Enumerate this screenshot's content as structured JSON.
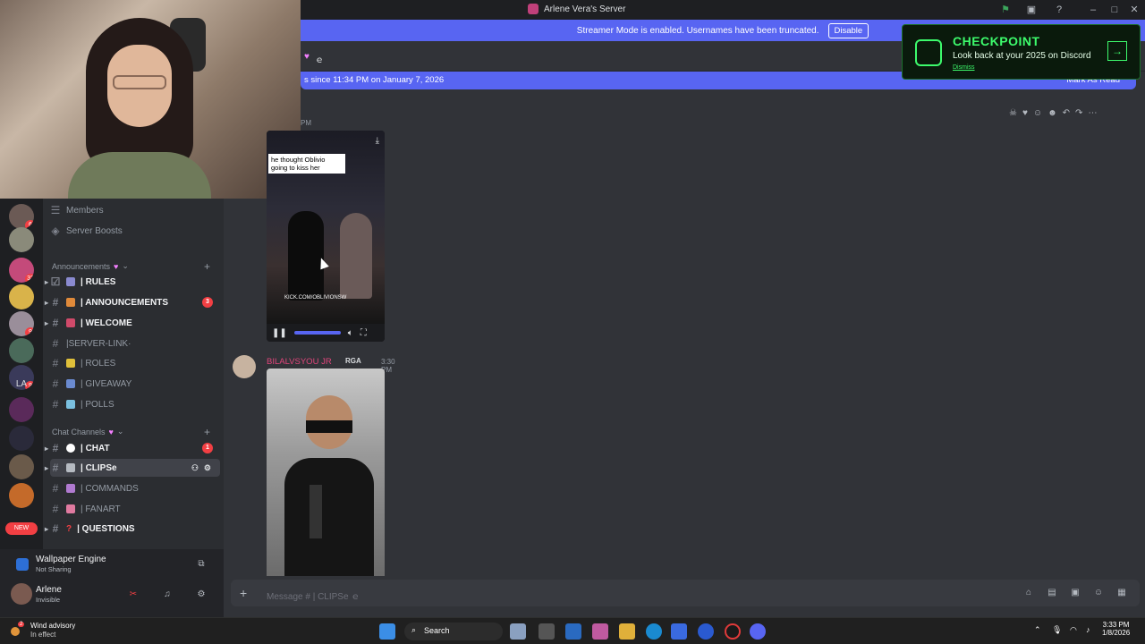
{
  "window": {
    "title": "Arlene Vera's Server"
  },
  "streamer_banner": {
    "text": "Streamer Mode is enabled. Usernames have been truncated.",
    "button": "Disable"
  },
  "channel_header": {
    "title": "ｅ"
  },
  "new_messages": {
    "text": "s since 11:34 PM on January 7, 2026",
    "action": "Mark As Read"
  },
  "checkpoint": {
    "title": "CHECKPOINT",
    "subtitle": "Look back at your 2025 on Discord",
    "dismiss": "Dismiss"
  },
  "sidebar": {
    "top_items": [
      {
        "label": "Members",
        "icon": "members-icon"
      },
      {
        "label": "Server Boosts",
        "icon": "boost-icon"
      }
    ],
    "categories": [
      {
        "label": "Announcements"
      },
      {
        "label": "Chat Channels"
      }
    ],
    "channels": [
      {
        "label": "| RULES",
        "bold": true
      },
      {
        "label": "| ANNOUNCEMENTS",
        "bold": true,
        "mentions": "3"
      },
      {
        "label": "| WELCOME",
        "bold": true
      },
      {
        "label": "|SERVER-LINK·",
        "bold": false
      },
      {
        "label": "| ROLES",
        "bold": false
      },
      {
        "label": "| GIVEAWAY",
        "bold": false
      },
      {
        "label": "| POLLS",
        "bold": false
      },
      {
        "label": "| CHAT",
        "bold": true,
        "mentions": "1"
      },
      {
        "label": "| CLIPSe",
        "bold": true,
        "selected": true
      },
      {
        "label": "| COMMANDS",
        "bold": false
      },
      {
        "label": "| FANART",
        "bold": false
      },
      {
        "label": "| QUESTIONS",
        "bold": true
      }
    ],
    "servers": [
      {
        "badge": "6"
      },
      {
        "badge": ""
      },
      {
        "badge": "32"
      },
      {
        "badge": ""
      },
      {
        "badge": "9"
      },
      {
        "badge": ""
      },
      {
        "badge": "9"
      },
      {
        "label": "LA"
      },
      {
        "badge": ""
      },
      {
        "badge": ""
      },
      {
        "badge": ""
      },
      {
        "badge": ""
      },
      {
        "badge": "NEW"
      }
    ]
  },
  "panel": {
    "activity_title": "Wallpaper Engine",
    "activity_sub": "Not Sharing",
    "user_name": "Arlene",
    "user_status": "Invisible"
  },
  "messages": [
    {
      "timestamp": "PM",
      "caption": "he thought Oblivio going to kiss her",
      "watermark": "KICK.COM/OBLIVIONSW"
    },
    {
      "author": "BILALVSYOU JR",
      "role": "RGA",
      "time": "3:30 PM"
    }
  ],
  "composer": {
    "placeholder": "Message #  | CLIPSe ｅ"
  },
  "taskbar": {
    "weather_title": "Wind advisory",
    "weather_sub": "In effect",
    "weather_badge": "2",
    "search": "Search",
    "time": "3:33 PM",
    "date": "1/8/2026"
  }
}
